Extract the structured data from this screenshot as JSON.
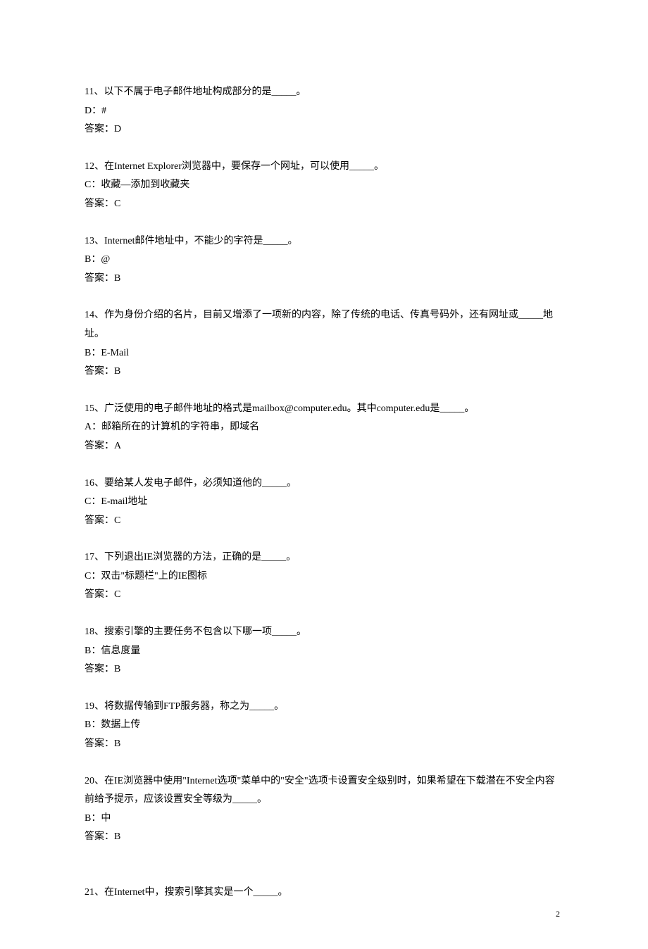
{
  "questions": [
    {
      "question": "11、以下不属于电子邮件地址构成部分的是_____。",
      "option": "D：#",
      "answer": "答案：D"
    },
    {
      "question": "12、在Internet Explorer浏览器中，要保存一个网址，可以使用_____。",
      "option": "C：收藏—添加到收藏夹",
      "answer": "答案：C"
    },
    {
      "question": "13、Internet邮件地址中，不能少的字符是_____。",
      "option": "B：@",
      "answer": "答案：B"
    },
    {
      "question": "14、作为身份介绍的名片，目前又增添了一项新的内容，除了传统的电话、传真号码外，还有网址或_____地址。",
      "option": "B：E-Mail",
      "answer": "答案：B"
    },
    {
      "question": "15、广泛使用的电子邮件地址的格式是mailbox@computer.edu。其中computer.edu是_____。",
      "option": "A：邮箱所在的计算机的字符串，即域名",
      "answer": "答案：A"
    },
    {
      "question": "16、要给某人发电子邮件，必须知道他的_____。",
      "option": "C：E-mail地址",
      "answer": "答案：C"
    },
    {
      "question": "17、下列退出IE浏览器的方法，正确的是_____。",
      "option": "C：双击\"标题栏\"上的IE图标",
      "answer": "答案：C"
    },
    {
      "question": "18、搜索引擎的主要任务不包含以下哪一项_____。",
      "option": "B：信息度量",
      "answer": "答案：B"
    },
    {
      "question": "19、将数据传输到FTP服务器，称之为_____。",
      "option": "B：数据上传",
      "answer": "答案：B"
    },
    {
      "question": "20、在IE浏览器中使用\"Internet选项\"菜单中的\"安全\"选项卡设置安全级别时，如果希望在下载潜在不安全内容前给予提示，应该设置安全等级为_____。",
      "option": "B：中",
      "answer": "答案：B"
    },
    {
      "question": "21、在Internet中，搜索引擎其实是一个_____。",
      "option": "",
      "answer": ""
    }
  ],
  "pageNumber": "2"
}
